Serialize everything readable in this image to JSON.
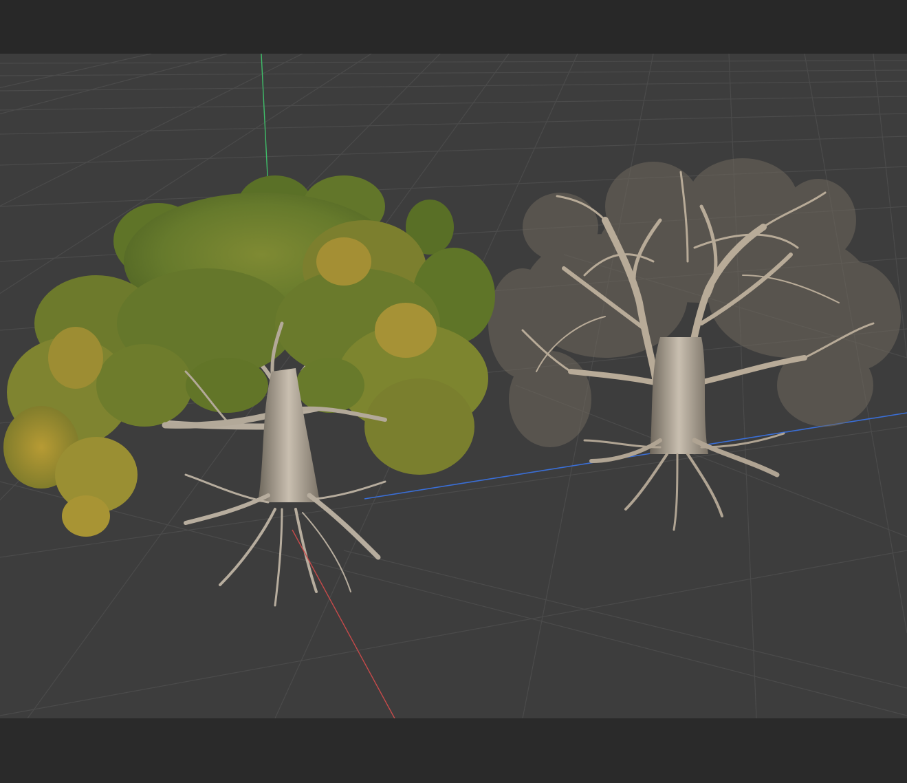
{
  "viewport": {
    "background_color": "#3d3d3d",
    "grid_color": "#4a4a4a",
    "axis_colors": {
      "x": "#c84a4a",
      "y": "#3fbf6a",
      "z": "#3a6fd8"
    }
  },
  "scene": {
    "objects": [
      {
        "id": "tree_leafy",
        "foliage_colors": [
          "#5f7a2a",
          "#7b8a2f",
          "#a59530"
        ],
        "bark_color": "#bdb3a4"
      },
      {
        "id": "tree_bare",
        "bark_color": "#b8ab98",
        "twig_color": "#9c907f"
      }
    ]
  }
}
